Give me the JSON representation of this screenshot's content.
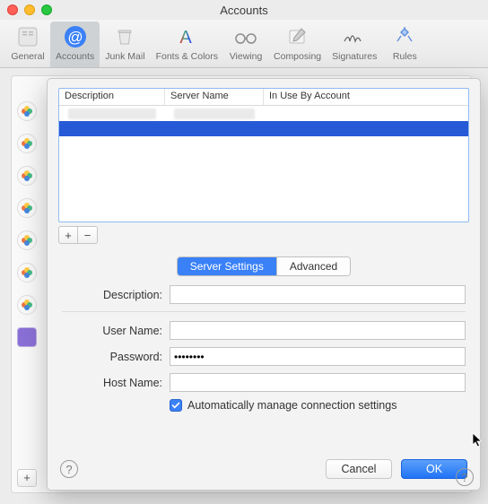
{
  "window": {
    "title": "Accounts"
  },
  "toolbar": {
    "items": [
      {
        "label": "General"
      },
      {
        "label": "Accounts"
      },
      {
        "label": "Junk Mail"
      },
      {
        "label": "Fonts & Colors"
      },
      {
        "label": "Viewing"
      },
      {
        "label": "Composing"
      },
      {
        "label": "Signatures"
      },
      {
        "label": "Rules"
      }
    ],
    "selected_index": 1
  },
  "table": {
    "columns": [
      "Description",
      "Server Name",
      "In Use By Account"
    ],
    "rows": [
      {
        "description": "",
        "server": "",
        "in_use": "",
        "selected": true
      }
    ]
  },
  "buttons": {
    "add": "+",
    "remove": "−",
    "back_add": "+"
  },
  "seg": {
    "server_settings": "Server Settings",
    "advanced": "Advanced"
  },
  "form": {
    "description_label": "Description:",
    "description_value": "",
    "username_label": "User Name:",
    "username_value": "",
    "password_label": "Password:",
    "password_value": "••••••••",
    "hostname_label": "Host Name:",
    "hostname_value": "",
    "auto_manage": "Automatically manage connection settings"
  },
  "footer": {
    "cancel": "Cancel",
    "ok": "OK",
    "help": "?"
  }
}
